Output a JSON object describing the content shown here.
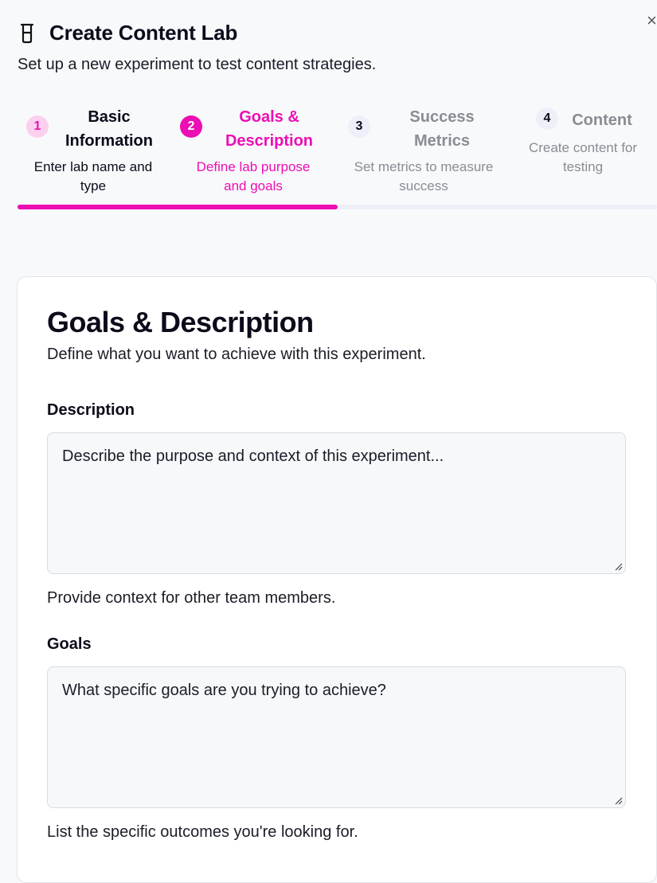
{
  "app": {
    "title": "Create Content Lab",
    "subtitle": "Set up a new experiment to test content strategies."
  },
  "steps": [
    {
      "number": "1",
      "title_line1": "Basic",
      "title_line2": "Information",
      "desc_line1": "Enter lab name and",
      "desc_line2": "type",
      "state": "completed"
    },
    {
      "number": "2",
      "title_line1": "Goals &",
      "title_line2": "Description",
      "desc_line1": "Define lab purpose",
      "desc_line2": "and goals",
      "state": "active"
    },
    {
      "number": "3",
      "title_line1": "Success",
      "title_line2": "Metrics",
      "desc_line1": "Set metrics to measure",
      "desc_line2": "success",
      "state": "upcoming"
    },
    {
      "number": "4",
      "title_line1": "Content",
      "desc_line1": "Create content for",
      "desc_line2": "testing",
      "state": "upcoming"
    }
  ],
  "progress": {
    "fraction": 0.5
  },
  "form": {
    "title": "Goals & Description",
    "subtitle": "Define what you want to achieve with this experiment.",
    "description": {
      "label": "Description",
      "placeholder": "Describe the purpose and context of this experiment...",
      "helper": "Provide context for other team members."
    },
    "goals": {
      "label": "Goals",
      "placeholder": "What specific goals are you trying to achieve?",
      "helper": "List the specific outcomes you're looking for."
    }
  },
  "icons": {
    "close": "close-icon",
    "beaker": "beaker-icon",
    "resize": "resize-grip-icon"
  },
  "colors": {
    "accent": "#ec0fb4",
    "accent_light": "#fbd0ef",
    "inactive_circle": "#efeff9",
    "muted_text": "#8b8b94"
  }
}
